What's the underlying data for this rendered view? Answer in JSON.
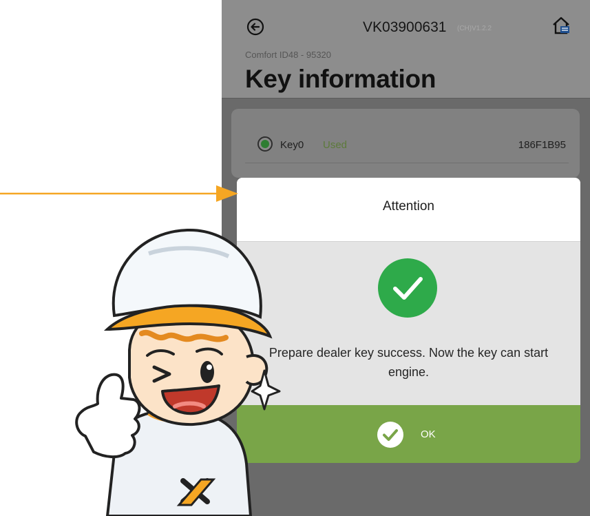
{
  "header": {
    "device_id": "VK03900631",
    "version": "(CH)V1.2.2",
    "sub_title": "Comfort ID48 - 95320",
    "title": "Key information"
  },
  "key_list": [
    {
      "name": "Key0",
      "status": "Used",
      "code": "186F1B95"
    }
  ],
  "dialog": {
    "title": "Attention",
    "message": "Prepare dealer key success. Now the key can start engine.",
    "ok_label": "OK"
  },
  "icons": {
    "back": "back-arrow-icon",
    "home": "home-icon",
    "success": "checkmark-circle-icon",
    "ok": "check-icon"
  },
  "colors": {
    "accent_green": "#79a548",
    "success_green": "#2eaa4a",
    "arrow_orange": "#f5a623"
  }
}
